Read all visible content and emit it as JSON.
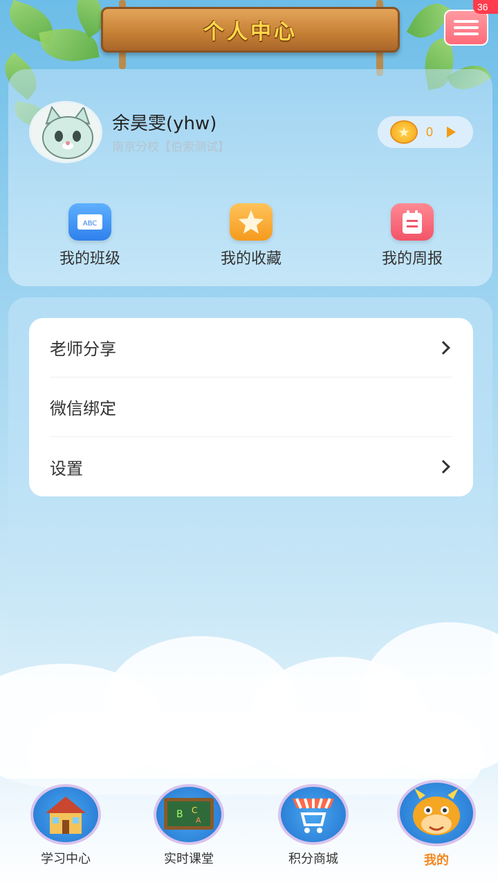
{
  "header": {
    "title": "个人中心",
    "message_badge": "36"
  },
  "profile": {
    "name": "余昊雯(yhw)",
    "school": "南京分校【伯索测试】",
    "points": "0"
  },
  "quick_actions": [
    {
      "label": "我的班级",
      "icon": "abc-board-icon",
      "color": "#3a8ff0"
    },
    {
      "label": "我的收藏",
      "icon": "star-icon",
      "color": "#f5a623"
    },
    {
      "label": "我的周报",
      "icon": "notepad-icon",
      "color": "#f25c6a"
    }
  ],
  "menu": [
    {
      "label": "老师分享",
      "has_arrow": true
    },
    {
      "label": "微信绑定",
      "has_arrow": false
    },
    {
      "label": "设置",
      "has_arrow": true
    }
  ],
  "bottom_nav": [
    {
      "label": "学习中心",
      "icon": "house-icon",
      "active": false
    },
    {
      "label": "实时课堂",
      "icon": "chalkboard-icon",
      "active": false
    },
    {
      "label": "积分商城",
      "icon": "shopping-cart-icon",
      "active": false
    },
    {
      "label": "我的",
      "icon": "cow-mascot-icon",
      "active": true
    }
  ],
  "colors": {
    "accent": "#f5871f",
    "sign_text": "#ffd84a"
  }
}
